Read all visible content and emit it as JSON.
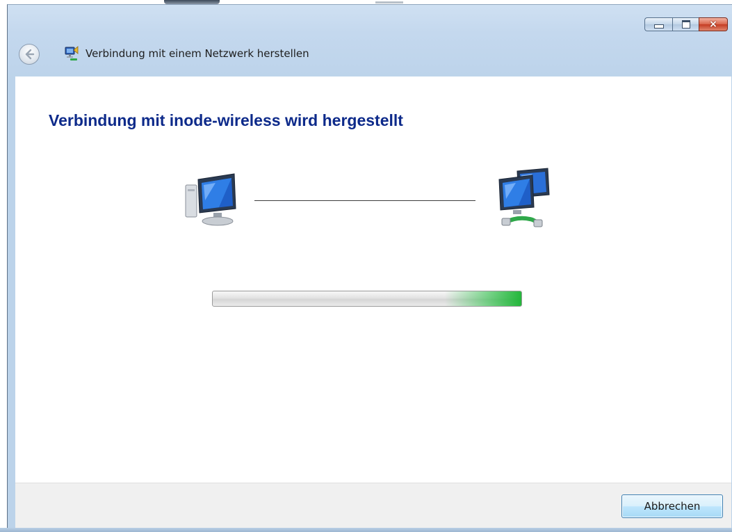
{
  "window": {
    "title": "Verbindung mit einem Netzwerk herstellen",
    "controls": {
      "minimize_icon": "minimize-icon",
      "maximize_icon": "maximize-icon",
      "close_icon": "close-icon",
      "close_glyph": "×"
    }
  },
  "navigation": {
    "back_icon": "back-arrow-icon"
  },
  "main": {
    "heading": "Verbindung mit inode-wireless wird hergestellt",
    "left_device_icon": "computer-icon",
    "right_device_icon": "network-computers-icon",
    "progress": {
      "state": "indeterminate",
      "accent_color": "#1eb43c"
    }
  },
  "footer": {
    "cancel_label": "Abbrechen"
  },
  "colors": {
    "heading": "#0d2a8a",
    "chrome": "#c4d8ee",
    "footer": "#f0f0f0",
    "close_button": "#c43c22"
  }
}
